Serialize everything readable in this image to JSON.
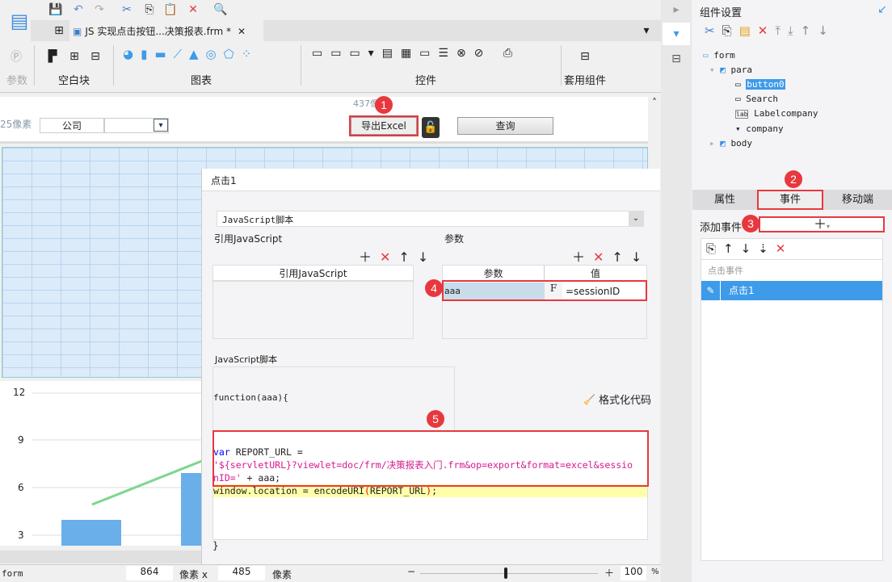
{
  "toolbar": {
    "tab_title": "JS 实现点击按钮...决策报表.frm *",
    "groups": {
      "param": "参数",
      "blank": "空白块",
      "chart": "图表",
      "widget": "控件",
      "template": "套用组件"
    }
  },
  "canvas": {
    "size_label": "437像",
    "height_label": "25像素",
    "label_company": "公司",
    "export_button": "导出Excel",
    "query_button": "查询"
  },
  "chart_preview": {
    "y_ticks": [
      "12",
      "9",
      "6",
      "3"
    ]
  },
  "dialog": {
    "title": "点击1",
    "type_select": "JavaScript脚本",
    "ref_js_section": "引用JavaScript",
    "ref_js_header": "引用JavaScript",
    "params_section": "参数",
    "params_header_name": "参数",
    "params_header_value": "值",
    "param_row": {
      "name": "aaa",
      "value": "=sessionID"
    },
    "script_section": "JavaScript脚本",
    "function_sig": "function(aaa){",
    "format_code": "格式化代码",
    "code": {
      "kw": "var",
      "line1": " REPORT_URL =",
      "line2": "'${servletURL}?viewlet=doc/frm/决策报表入门.frm&op=export&format=excel&sessio",
      "line3a": "nID='",
      "line3b": " + aaa;",
      "line4a": "window.location = encodeURI",
      "line4b": "(",
      "line4c": "REPORT_URL",
      "line4d": ")",
      "line4e": ";"
    },
    "closing": "}"
  },
  "right_panel": {
    "title": "组件设置",
    "tree": [
      {
        "label": "form"
      },
      {
        "label": "para"
      },
      {
        "label": "button0",
        "selected": true
      },
      {
        "label": "Search"
      },
      {
        "label": "Labelcompany"
      },
      {
        "label": "company"
      },
      {
        "label": "body"
      }
    ],
    "tabs": [
      "属性",
      "事件",
      "移动端"
    ],
    "active_tab": "事件",
    "add_event_label": "添加事件",
    "event_group": "点击事件",
    "event_item": "点击1"
  },
  "badges": [
    "1",
    "2",
    "3",
    "4",
    "5"
  ],
  "status": {
    "form": "form",
    "width": "864",
    "unit1": "像素 x",
    "height": "485",
    "unit2": "像素",
    "zoom": "100",
    "percent": "%"
  },
  "colors": {
    "accent": "#3d9be9",
    "highlight_red": "#e8383d",
    "bar": "#6aaeea",
    "line": "#7dd68f"
  }
}
